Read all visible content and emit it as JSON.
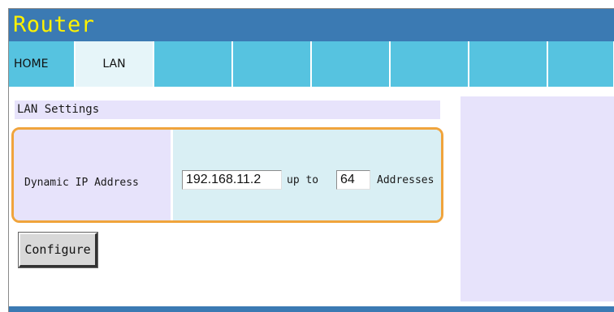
{
  "header": {
    "title": "Router"
  },
  "nav": {
    "tabs": [
      {
        "label": "HOME"
      },
      {
        "label": "LAN"
      },
      {
        "label": ""
      },
      {
        "label": ""
      },
      {
        "label": ""
      },
      {
        "label": ""
      },
      {
        "label": ""
      },
      {
        "label": ""
      }
    ]
  },
  "section": {
    "title": "LAN Settings"
  },
  "dhcp": {
    "label": "Dynamic IP Address",
    "start_ip": "192.168.11.2",
    "up_to": "up to",
    "count": "64",
    "addresses": "Addresses"
  },
  "actions": {
    "configure_label": "Configure"
  },
  "colors": {
    "header_bg": "#3b7ab3",
    "title_text": "#fff200",
    "tab_bg": "#56c3e0",
    "tab_active_bg": "#e6f5f9",
    "panel_lavender": "#e7e3fb",
    "value_cell": "#d9eff4",
    "highlight_border": "#f0a43c"
  }
}
